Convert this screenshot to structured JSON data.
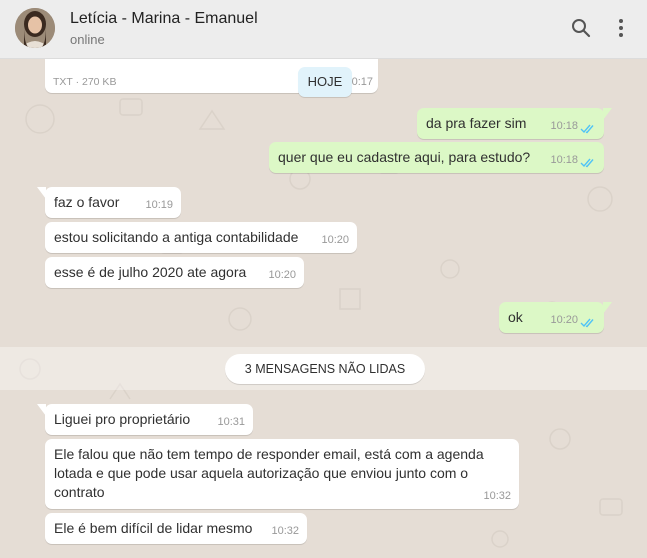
{
  "header": {
    "title": "Letícia - Marina - Emanuel",
    "status": "online",
    "icons": [
      "search-icon",
      "menu-dots-icon"
    ]
  },
  "file_message": {
    "type": "TXT",
    "size": "270 KB",
    "time": "0:17"
  },
  "date_chip": "HOJE",
  "unread_divider": "3 MENSAGENS NÃO LIDAS",
  "messages": [
    {
      "dir": "out",
      "text": "da pra fazer sim",
      "time": "10:18"
    },
    {
      "dir": "out",
      "text": "quer que eu cadastre aqui, para estudo?",
      "time": "10:18"
    },
    {
      "dir": "in",
      "text": "faz o favor",
      "time": "10:19"
    },
    {
      "dir": "in",
      "text": "estou solicitando a antiga contabilidade",
      "time": "10:20"
    },
    {
      "dir": "in",
      "text": "esse é de julho 2020 ate agora",
      "time": "10:20"
    },
    {
      "dir": "out",
      "text": "ok",
      "time": "10:20"
    },
    {
      "dir": "in",
      "text": "Liguei pro proprietário",
      "time": "10:31"
    },
    {
      "dir": "in",
      "text": "Ele falou que não tem tempo de responder email, está com a agenda lotada e que pode usar aquela autorização que enviou junto com o contrato",
      "time": "10:32"
    },
    {
      "dir": "in",
      "text": "Ele é bem difícil de lidar mesmo",
      "time": "10:32"
    }
  ],
  "colors": {
    "outgoing_bubble": "#dcf8c6",
    "incoming_bubble": "#ffffff",
    "read_ticks": "#4fc3f7",
    "chat_background": "#e5ddd5",
    "header_background": "#ededed"
  }
}
